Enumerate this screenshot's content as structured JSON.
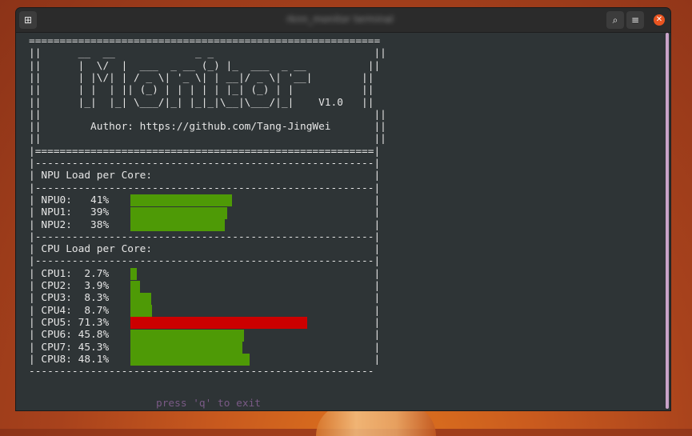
{
  "window": {
    "title": "rknn_monitor terminal"
  },
  "toolbar": {
    "new_tab_icon": "new-tab-icon",
    "search_icon": "search-icon",
    "menu_icon": "hamburger-icon",
    "close_icon": "close-icon"
  },
  "terminal": {
    "lines": [
      "=========================================================",
      "||      __  __             _ _                          ||",
      "||      |  \\/  |  ___  _ __ (_) |_  ___  _ __          ||",
      "||      | |\\/| | / _ \\| '_ \\| | __|/ _ \\| '__|        ||",
      "||      | |  | || (_) | | | | | |_| (_) | |           ||",
      "||      |_|  |_| \\___/|_| |_|_|\\__|\\___/|_|    V1.0   ||",
      "||                                                      ||",
      "||        Author: https://github.com/Tang-JingWei       ||",
      "||                                                      ||",
      "|=======================================================|",
      "|-------------------------------------------------------|",
      "| NPU Load per Core:                                    |",
      "|-------------------------------------------------------|",
      "| NPU0:   41%                                           |",
      "| NPU1:   39%                                           |",
      "| NPU2:   38%                                           |",
      "|-------------------------------------------------------|",
      "| CPU Load per Core:                                    |",
      "|-------------------------------------------------------|",
      "| CPU1:  2.7%                                           |",
      "| CPU2:  3.9%                                           |",
      "| CPU3:  8.3%                                           |",
      "| CPU4:  8.7%                                           |",
      "| CPU5: 71.3%                                           |",
      "| CPU6: 45.8%                                           |",
      "| CPU7: 45.3%                                           |",
      "| CPU8: 48.1%                                           |",
      "--------------------------------------------------------"
    ],
    "exit_hint": "press 'q' to exit"
  },
  "npu": [
    {
      "name": "NPU0",
      "load": 41
    },
    {
      "name": "NPU1",
      "load": 39
    },
    {
      "name": "NPU2",
      "load": 38
    }
  ],
  "cpu": [
    {
      "name": "CPU1",
      "load": 2.7
    },
    {
      "name": "CPU2",
      "load": 3.9
    },
    {
      "name": "CPU3",
      "load": 8.3
    },
    {
      "name": "CPU4",
      "load": 8.7
    },
    {
      "name": "CPU5",
      "load": 71.3
    },
    {
      "name": "CPU6",
      "load": 45.8
    },
    {
      "name": "CPU7",
      "load": 45.3
    },
    {
      "name": "CPU8",
      "load": 48.1
    }
  ],
  "colors": {
    "normal": "#4e9a06",
    "high": "#cc0000",
    "exit_hint": "#7a5a86"
  }
}
